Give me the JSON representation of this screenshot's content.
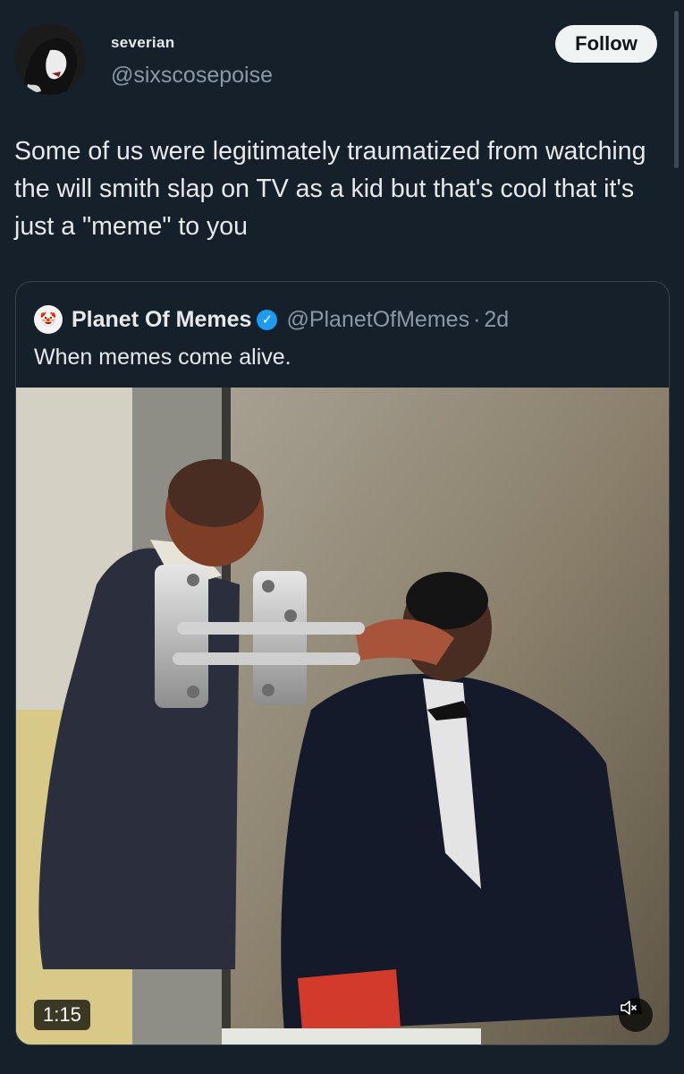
{
  "tweet": {
    "display_name": "severian",
    "handle": "@sixscosepoise",
    "follow_label": "Follow",
    "text": "Some of us were legitimately traumatized from watching the will smith slap on TV as a kid but that's cool that it's just a \"meme\" to you"
  },
  "quoted_tweet": {
    "name": "Planet Of Memes",
    "handle": "@PlanetOfMemes",
    "separator": "·",
    "time": "2d",
    "text": "When memes come alive.",
    "video_duration": "1:15"
  },
  "icons": {
    "verified": "verified-badge-icon",
    "mute": "volume-muted-icon"
  },
  "colors": {
    "background": "#15202b",
    "verified": "#1d9bf0",
    "secondary_text": "#8b98a5"
  }
}
